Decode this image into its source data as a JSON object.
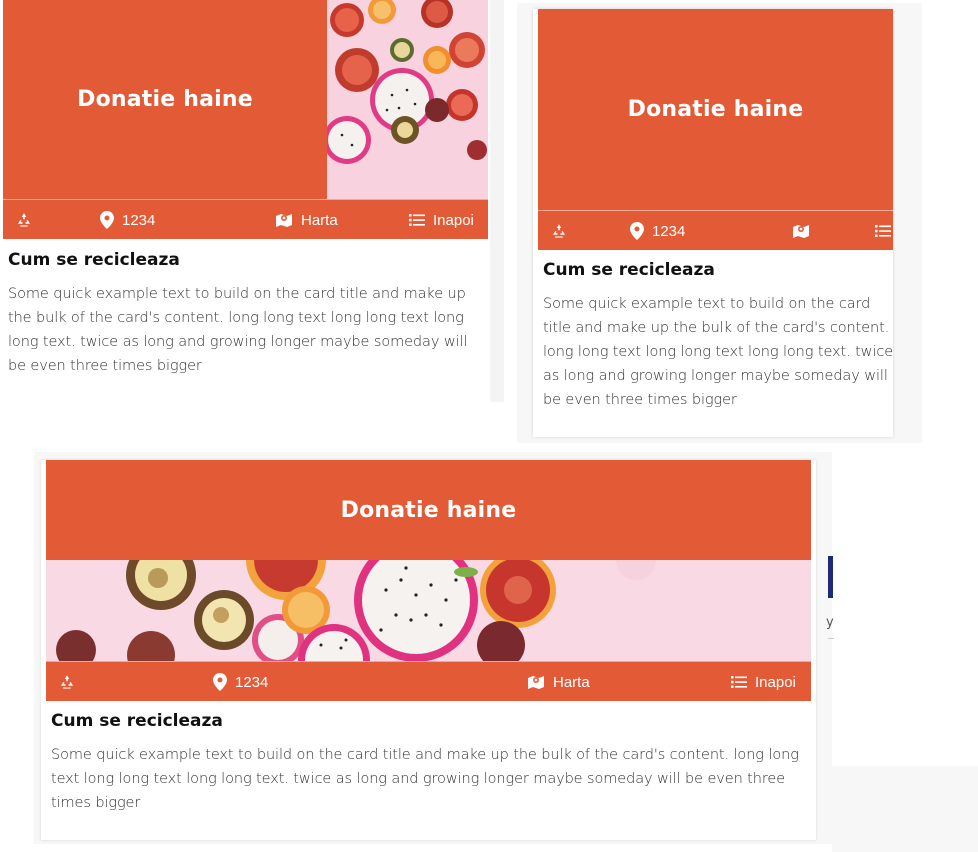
{
  "cards": [
    {
      "title": "Donatie haine",
      "recycle_icon": "recycle-icon",
      "location_number": "1234",
      "map_label": "Harta",
      "back_label": "Inapoi",
      "heading": "Cum se recicleaza",
      "body": "Some quick example text to build on the card title and make up the bulk of the card's content. long long text long long text long long text. twice as long and growing longer maybe someday will be even three times bigger"
    },
    {
      "title": "Donatie haine",
      "recycle_icon": "recycle-icon",
      "location_number": "1234",
      "heading": "Cum se recicleaza",
      "body": "Some quick example text to build on the card title and make up the bulk of the card's content. long long text long long text long long text. twice as long and growing longer maybe someday will be even three times bigger"
    },
    {
      "title": "Donatie haine",
      "recycle_icon": "recycle-icon",
      "location_number": "1234",
      "map_label": "Harta",
      "back_label": "Inapoi",
      "heading": "Cum se recicleaza",
      "body": "Some quick example text to build on the card title and make up the bulk of the card's content. long long text long long text long long text. twice as long and growing longer maybe someday will be even three times bigger"
    }
  ],
  "colors": {
    "accent": "#e35b36",
    "photo_background": "#f9d6e2"
  },
  "partial_text": "y"
}
